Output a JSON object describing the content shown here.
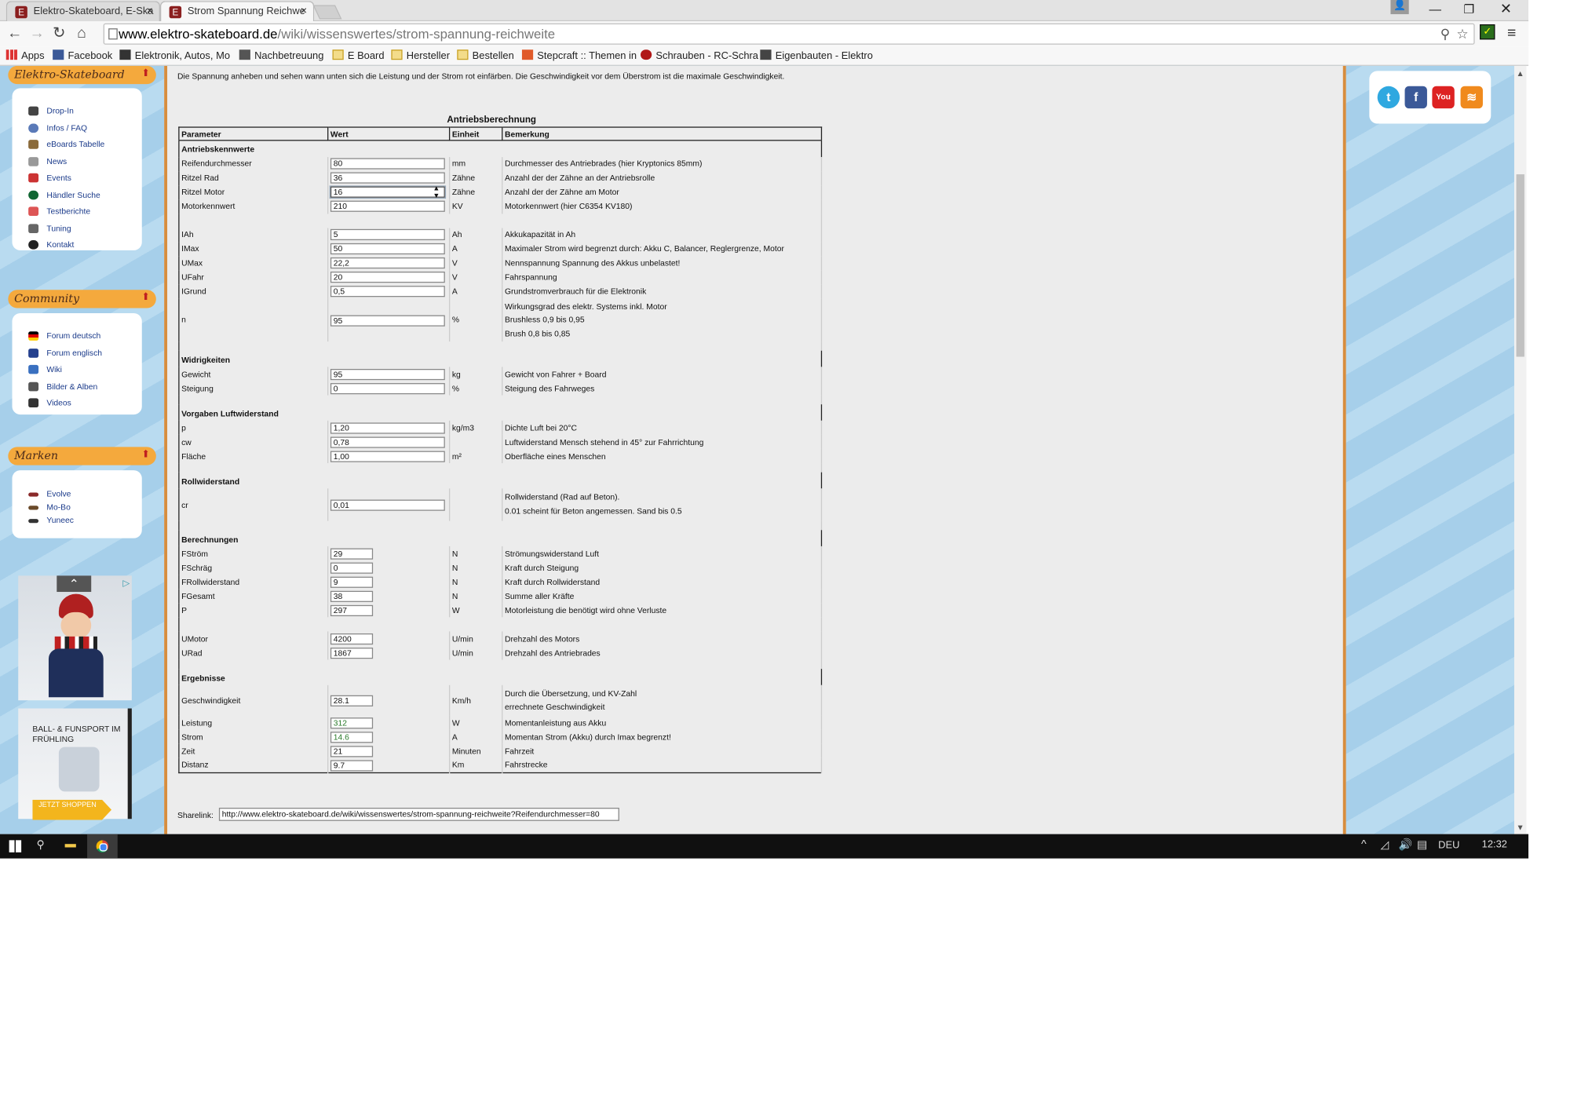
{
  "browser": {
    "tabs": [
      {
        "title": "Elektro-Skateboard, E-Ska",
        "close": "×"
      },
      {
        "title": "Strom Spannung Reichwe",
        "close": "×"
      }
    ],
    "url_host": "www.elektro-skateboard.de",
    "url_path": "/wiki/wissenswertes/strom-spannung-reichweite",
    "bookmarks": [
      "Apps",
      "Facebook",
      "Elektronik, Autos, Mo",
      "Nachbetreuung",
      "E Board",
      "Hersteller",
      "Bestellen",
      "Stepcraft :: Themen in",
      "Schrauben - RC-Schra",
      "Eigenbauten - Elektro"
    ]
  },
  "sidebar": {
    "sections": [
      {
        "title": "Elektro-Skateboard",
        "items": [
          "Drop-In",
          "Infos / FAQ",
          "eBoards Tabelle",
          "News",
          "Events",
          "Händler Suche",
          "Testberichte",
          "Tuning",
          "Kontakt"
        ]
      },
      {
        "title": "Community",
        "items": [
          "Forum deutsch",
          "Forum englisch",
          "Wiki",
          "Bilder & Alben",
          "Videos"
        ]
      },
      {
        "title": "Marken",
        "items": [
          "Evolve",
          "Mo-Bo",
          "Yuneec"
        ]
      }
    ],
    "ad2_text": "BALL- & FUNSPORT IM FRÜHLING",
    "ad2_button": "JETZT SHOPPEN",
    "ad_info": "▷"
  },
  "main": {
    "intro": "Die Spannung anheben und sehen wann unten sich die Leistung und der Strom rot einfärben. Die Geschwindigkeit vor dem Überstrom ist die maximale Geschwindigkeit.",
    "calc_title": "Antriebsberechnung",
    "headers": [
      "Parameter",
      "Wert",
      "Einheit",
      "Bemerkung"
    ],
    "sec1": "Antriebskennwerte",
    "r1": {
      "p": "Reifendurchmesser",
      "v": "80",
      "u": "mm",
      "b": "Durchmesser des Antriebrades (hier Kryptonics 85mm)"
    },
    "r2": {
      "p": "Ritzel Rad",
      "v": "36",
      "u": "Zähne",
      "b": "Anzahl der der Zähne an der Antriebsrolle"
    },
    "r3": {
      "p": "Ritzel Motor",
      "v": "16",
      "u": "Zähne",
      "b": "Anzahl der der Zähne am Motor"
    },
    "r4": {
      "p": "Motorkennwert",
      "v": "210",
      "u": "KV",
      "b": "Motorkennwert (hier C6354 KV180)"
    },
    "r5": {
      "p": "IAh",
      "v": "5",
      "u": "Ah",
      "b": "Akkukapazität in Ah"
    },
    "r6": {
      "p": "IMax",
      "v": "50",
      "u": "A",
      "b": "Maximaler Strom wird begrenzt durch: Akku C, Balancer, Reglergrenze, Motor"
    },
    "r7": {
      "p": "UMax",
      "v": "22,2",
      "u": "V",
      "b": "Nennspannung Spannung des Akkus unbelastet!"
    },
    "r8": {
      "p": "UFahr",
      "v": "20",
      "u": "V",
      "b": "Fahrspannung"
    },
    "r9": {
      "p": "IGrund",
      "v": "0,5",
      "u": "A",
      "b": "Grundstromverbrauch für die Elektronik"
    },
    "r10": {
      "p": "n",
      "v": "95",
      "u": "%",
      "b1": "Wirkungsgrad des elektr. Systems inkl. Motor",
      "b2": "Brushless 0,9 bis 0,95",
      "b3": "Brush 0,8 bis 0,85"
    },
    "sec2": "Widrigkeiten",
    "r11": {
      "p": "Gewicht",
      "v": "95",
      "u": "kg",
      "b": "Gewicht von Fahrer + Board"
    },
    "r12": {
      "p": "Steigung",
      "v": "0",
      "u": "%",
      "b": "Steigung des Fahrweges"
    },
    "sec3": "Vorgaben Luftwiderstand",
    "r13": {
      "p": "p",
      "v": "1,20",
      "u": "kg/m3",
      "b": "Dichte Luft bei 20°C"
    },
    "r14": {
      "p": "cw",
      "v": "0,78",
      "u": "",
      "b": "Luftwiderstand Mensch stehend in 45° zur Fahrrichtung"
    },
    "r15": {
      "p": "Fläche",
      "v": "1,00",
      "u": "m²",
      "b": "Oberfläche eines Menschen"
    },
    "sec4": "Rollwiderstand",
    "r16": {
      "p": "cr",
      "v": "0,01",
      "u": "",
      "b1": "Rollwiderstand (Rad auf Beton).",
      "b2": "0.01 scheint für Beton angemessen. Sand bis 0.5"
    },
    "sec5": "Berechnungen",
    "r17": {
      "p": "FStröm",
      "v": "29",
      "u": "N",
      "b": "Strömungswiderstand Luft"
    },
    "r18": {
      "p": "FSchräg",
      "v": "0",
      "u": "N",
      "b": "Kraft durch Steigung"
    },
    "r19": {
      "p": "FRollwiderstand",
      "v": "9",
      "u": "N",
      "b": "Kraft durch Rollwiderstand"
    },
    "r20": {
      "p": "FGesamt",
      "v": "38",
      "u": "N",
      "b": "Summe aller Kräfte"
    },
    "r21": {
      "p": "P",
      "v": "297",
      "u": "W",
      "b": "Motorleistung die benötigt wird ohne Verluste"
    },
    "r22": {
      "p": "UMotor",
      "v": "4200",
      "u": "U/min",
      "b": "Drehzahl des Motors"
    },
    "r23": {
      "p": "URad",
      "v": "1867",
      "u": "U/min",
      "b": "Drehzahl des Antriebrades"
    },
    "sec6": "Ergebnisse",
    "r24": {
      "p": "Geschwindigkeit",
      "v": "28.1",
      "u": "Km/h",
      "b1": "Durch die Übersetzung, und KV-Zahl",
      "b2": "errechnete Geschwindigkeit"
    },
    "r25": {
      "p": "Leistung",
      "v": "312",
      "u": "W",
      "b": "Momentanleistung aus Akku"
    },
    "r26": {
      "p": "Strom",
      "v": "14.6",
      "u": "A",
      "b": "Momentan Strom (Akku) durch Imax begrenzt!"
    },
    "r27": {
      "p": "Zeit",
      "v": "21",
      "u": "Minuten",
      "b": "Fahrzeit"
    },
    "r28": {
      "p": "Distanz",
      "v": "9.7",
      "u": "Km",
      "b": "Fahrstrecke"
    },
    "share_label": "Sharelink:",
    "share_url": "http://www.elektro-skateboard.de/wiki/wissenswertes/strom-spannung-reichweite?Reifendurchmesser=80"
  },
  "social": {
    "twitter": "t",
    "facebook": "f",
    "youtube": "You",
    "rss": "≋"
  },
  "taskbar": {
    "lang": "DEU",
    "time": "12:32"
  },
  "colors": {
    "accent_orange": "#f4a93d",
    "result_green": "#2a7a2a",
    "page_blue": "#a9d2ec"
  }
}
